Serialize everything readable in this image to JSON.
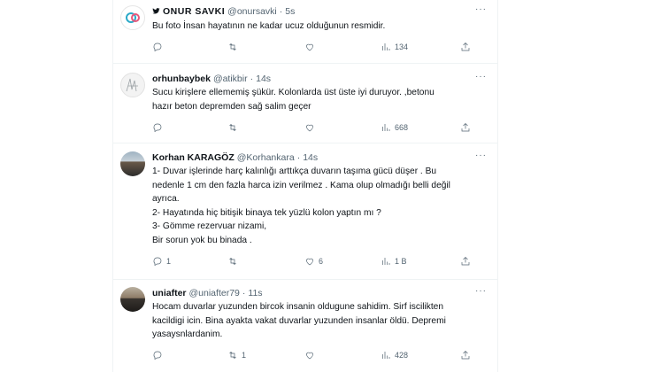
{
  "tweets": [
    {
      "name": "ONUR SAVKI",
      "handle": "@onursavki",
      "time": "5s",
      "text": [
        "Bu foto İnsan hayatının ne kadar ucuz olduğunun resmidir."
      ],
      "replies": "",
      "retweets": "",
      "likes": "",
      "views": "134",
      "avatar": "onur-logo-avatar",
      "badge": "bird-icon"
    },
    {
      "name": "orhunbaybek",
      "handle": "@atikbir",
      "time": "14s",
      "text": [
        "Sucu kirişlere ellememiş şükür. Kolonlarda üst üste iyi duruyor. ,betonu",
        "hazır beton depremden sağ salim geçer"
      ],
      "replies": "",
      "retweets": "",
      "likes": "",
      "views": "668",
      "avatar": "sketch-avatar"
    },
    {
      "name": "Korhan KARAGÖZ",
      "handle": "@Korhankara",
      "time": "14s",
      "text": [
        "1- Duvar işlerinde harç kalınlığı arttıkça duvarın taşıma gücü düşer . Bu",
        "nedenle 1 cm den fazla harca izin verilmez . Kama olup olmadığı belli değil",
        "ayrıca.",
        "2- Hayatında hiç bitişik binaya tek yüzlü kolon yaptın mı ?",
        "3- Gömme rezervuar nizami,",
        "Bir sorun yok bu binada ."
      ],
      "replies": "1",
      "retweets": "",
      "likes": "6",
      "views": "1 B",
      "avatar": "photo-avatar"
    },
    {
      "name": "uniafter",
      "handle": "@uniafter79",
      "time": "11s",
      "text": [
        "Hocam duvarlar yuzunden bircok insanin oldugune sahidim. Sirf iscilikten",
        "kacildigi icin. Bina ayakta vakat duvarlar yuzunden insanlar öldü. Depremi",
        "yasaysnlardanim."
      ],
      "replies": "",
      "retweets": "1",
      "likes": "",
      "views": "428",
      "avatar": "photo-avatar"
    }
  ],
  "more_glyph": "···",
  "colors": {
    "text": "#0f1419",
    "muted": "#536471",
    "border": "#eff3f4",
    "logo_pink": "#e8577b",
    "logo_teal": "#2aa9c8"
  }
}
